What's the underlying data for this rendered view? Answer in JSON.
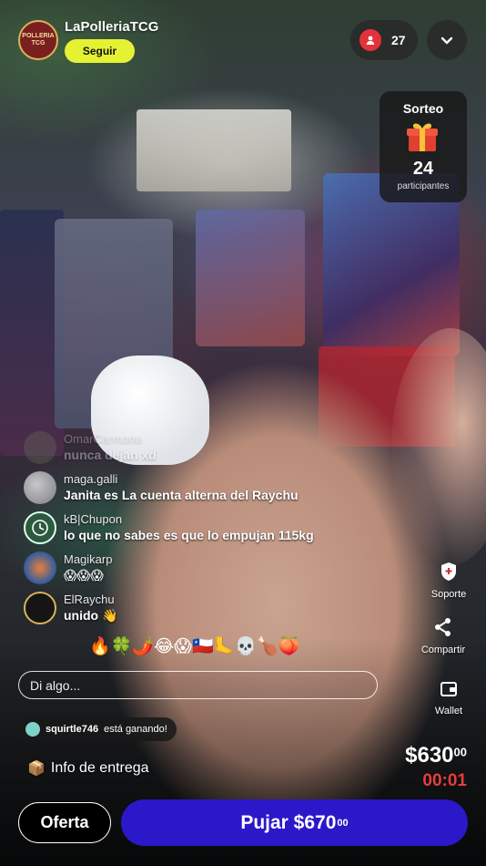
{
  "header": {
    "avatar_text": "POLLERIA TCG",
    "username": "LaPolleriaTCG",
    "follow_label": "Seguir",
    "viewer_count": "27"
  },
  "raffle": {
    "title": "Sorteo",
    "count": "24",
    "subtitle": "participantes"
  },
  "chat": [
    {
      "name": "OmarCarmona",
      "message": "nunca dejan xd"
    },
    {
      "name": "maga.galli",
      "message": "Janita es La cuenta alterna del Raychu"
    },
    {
      "name": "kB|Chupon",
      "message": "lo que no sabes es que lo empujan 115kg"
    },
    {
      "name": "Magikarp",
      "message": "😱😱😱"
    },
    {
      "name": "ElRaychu",
      "message": "unido 👋"
    }
  ],
  "reactions": "🔥🍀🌶️😂😱🇨🇱🦶💀🍗🍑",
  "input": {
    "placeholder": "Di algo..."
  },
  "side_actions": {
    "support": "Soporte",
    "share": "Compartir",
    "wallet": "Wallet"
  },
  "winner": {
    "name": "squirtle746",
    "text": "está ganando!"
  },
  "delivery": {
    "icon": "📦",
    "label": "Info de entrega"
  },
  "auction": {
    "price_main": "$630",
    "price_cents": "00",
    "timer": "00:01",
    "offer_label": "Oferta",
    "bid_label": "Pujar $670",
    "bid_cents": "00"
  },
  "colors": {
    "follow_button": "#e4f233",
    "bid_button": "#2b18c9",
    "timer": "#e83c3c",
    "viewer_icon": "#e3323b"
  }
}
